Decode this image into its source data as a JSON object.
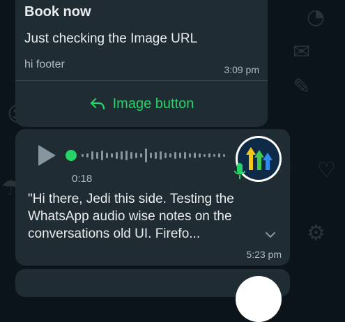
{
  "template_message": {
    "header": "Book now",
    "body": "Just checking the Image URL",
    "footer": "hi footer",
    "time": "3:09 pm",
    "button_label": "Image button",
    "button_icon": "reply-arrow-icon"
  },
  "audio_message": {
    "duration": "0:18",
    "transcript": "\"Hi there, Jedi this side. Testing the WhatsApp audio wise notes on the conversations old UI. Firefo...",
    "time": "5:23 pm",
    "progress": 0
  },
  "colors": {
    "background": "#0b141a",
    "bubble": "#202c33",
    "accent_green": "#25d366",
    "secondary_text": "#aebac1",
    "avatar_bg": "#0e2a47",
    "logo_yellow": "#f5c518",
    "logo_green": "#3ecb4f",
    "logo_blue": "#2d8cf0"
  }
}
